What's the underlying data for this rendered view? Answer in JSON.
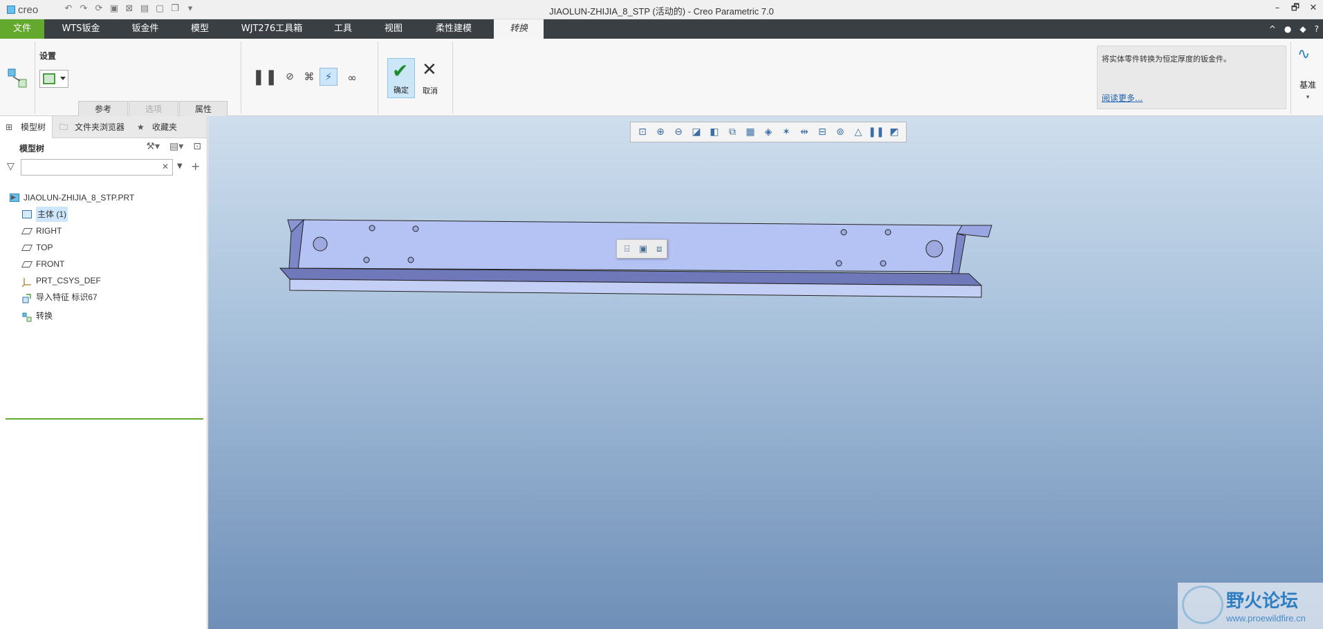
{
  "titlebar": {
    "app_logo": "creo",
    "title": "JIAOLUN-ZHIJIA_8_STP (活动的) - Creo Parametric 7.0",
    "window_controls": [
      "–",
      "🗗",
      "✕"
    ]
  },
  "menubar": {
    "tabs": [
      "文件",
      "WTS钣金",
      "钣金件",
      "模型",
      "WJT276工具箱",
      "工具",
      "视图",
      "柔性建模",
      "转换"
    ],
    "active_tab": "转换",
    "right_icons": [
      "^",
      "●",
      "◆",
      "?"
    ]
  },
  "ribbon": {
    "settings_label": "设置",
    "subtabs": [
      "参考",
      "选项",
      "属性"
    ],
    "ok_label": "确定",
    "cancel_label": "取消",
    "info_text": "将实体零件转换为恒定厚度的钣金件。",
    "info_link": "阅读更多...",
    "datum_label": "基准"
  },
  "left_panel": {
    "tabs": [
      "模型树",
      "文件夹浏览器",
      "收藏夹"
    ],
    "tree_label": "模型树",
    "filter_placeholder": "",
    "items": [
      {
        "label": "JIAOLUN-ZHIJIA_8_STP.PRT"
      },
      {
        "label": "主体 (1)"
      },
      {
        "label": "RIGHT"
      },
      {
        "label": "TOP"
      },
      {
        "label": "FRONT"
      },
      {
        "label": "PRT_CSYS_DEF"
      },
      {
        "label": "导入特征 标识67"
      },
      {
        "label": "转换"
      }
    ]
  },
  "viewport": {
    "model_fill": "#b5c3f4",
    "model_shade": "#7c87c7",
    "background_top": "#cfdeed",
    "background_bottom": "#6f8fb8"
  },
  "watermark": {
    "brand": "野火论坛",
    "url": "www.proewildfire.cn"
  }
}
